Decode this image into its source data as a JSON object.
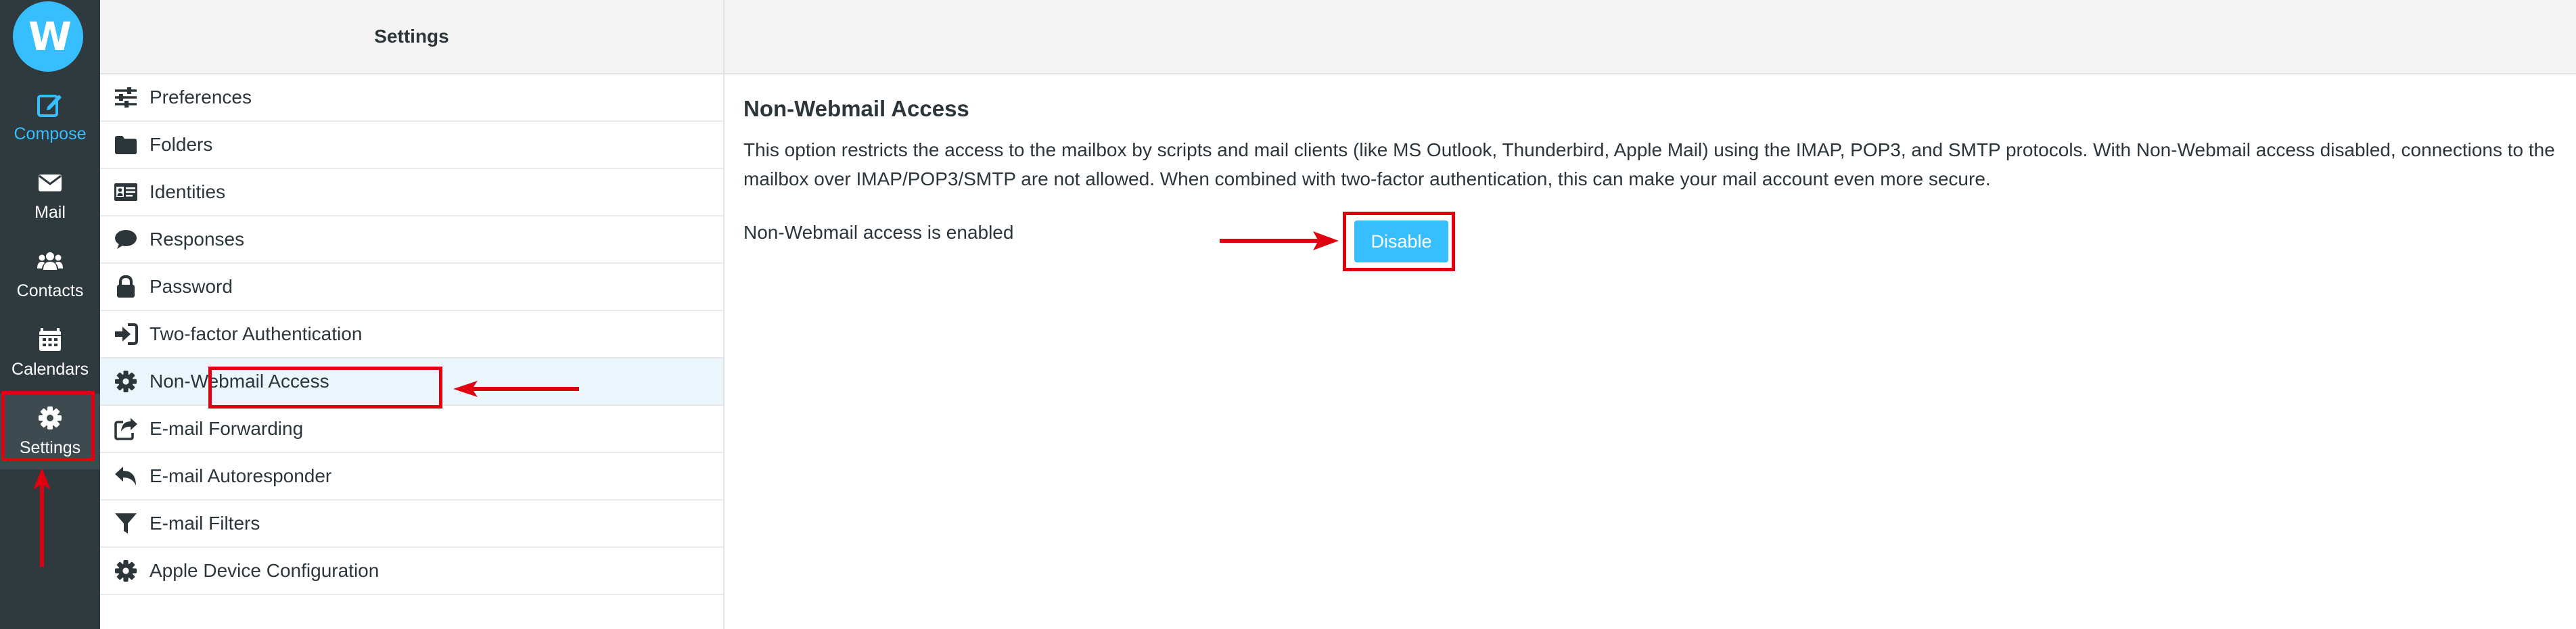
{
  "logo": {
    "text": "W"
  },
  "rail": {
    "items": [
      {
        "label": "Compose",
        "icon": "compose-icon"
      },
      {
        "label": "Mail",
        "icon": "envelope-icon"
      },
      {
        "label": "Contacts",
        "icon": "users-icon"
      },
      {
        "label": "Calendars",
        "icon": "calendar-icon"
      },
      {
        "label": "Settings",
        "icon": "gear-icon"
      }
    ]
  },
  "settings_list": {
    "title": "Settings",
    "items": [
      {
        "label": "Preferences",
        "icon": "sliders-icon"
      },
      {
        "label": "Folders",
        "icon": "folder-icon"
      },
      {
        "label": "Identities",
        "icon": "id-card-icon"
      },
      {
        "label": "Responses",
        "icon": "comment-icon"
      },
      {
        "label": "Password",
        "icon": "lock-icon"
      },
      {
        "label": "Two-factor Authentication",
        "icon": "sign-in-icon"
      },
      {
        "label": "Non-Webmail Access",
        "icon": "gear-icon",
        "selected": true
      },
      {
        "label": "E-mail Forwarding",
        "icon": "share-icon"
      },
      {
        "label": "E-mail Autoresponder",
        "icon": "reply-icon"
      },
      {
        "label": "E-mail Filters",
        "icon": "filter-icon"
      },
      {
        "label": "Apple Device Configuration",
        "icon": "gear-icon"
      }
    ]
  },
  "content": {
    "title": "Non-Webmail Access",
    "description": "This option restricts the access to the mailbox by scripts and mail clients (like MS Outlook, Thunderbird, Apple Mail) using the IMAP, POP3, and SMTP protocols. With Non-Webmail access disabled, connections to the mailbox over IMAP/POP3/SMTP are not allowed. When combined with two-factor authentication, this can make your mail account even more secure.",
    "status": "Non-Webmail access is enabled",
    "button_label": "Disable"
  },
  "colors": {
    "rail_bg": "#2f3a3f",
    "accent": "#37beff",
    "annotation_red": "#e0000f",
    "selected_row_bg": "#ebf6fc"
  }
}
